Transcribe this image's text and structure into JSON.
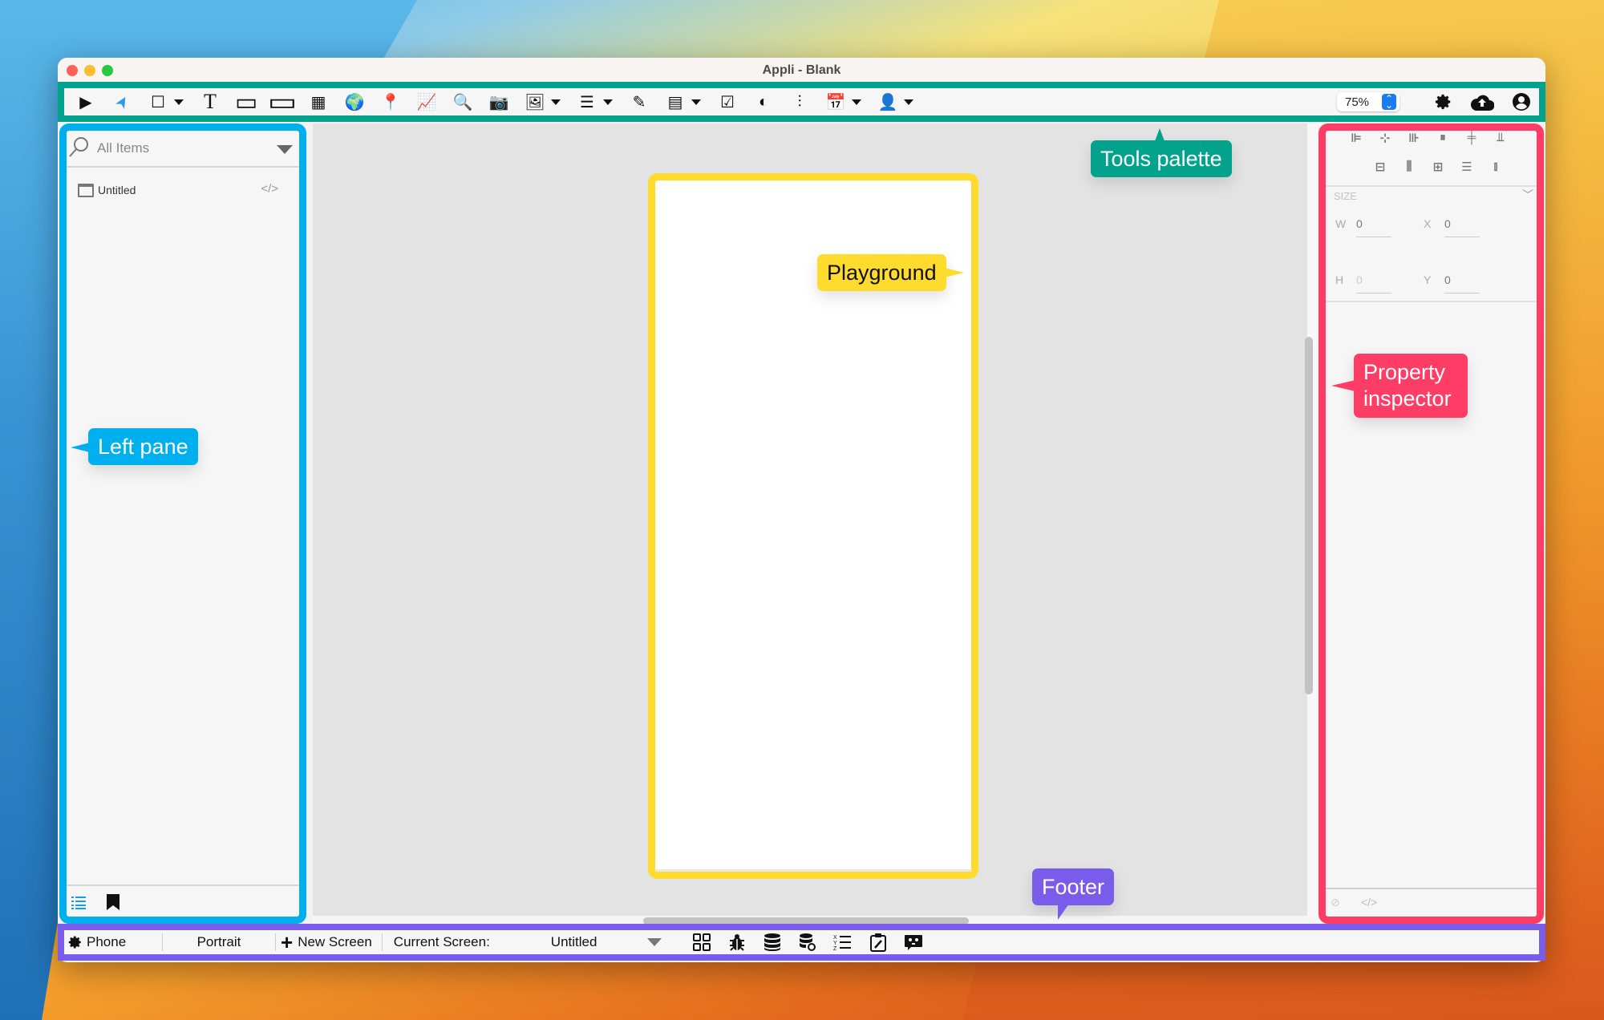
{
  "window": {
    "title": "Appli - Blank"
  },
  "toolbar": {
    "tools": [
      {
        "name": "play-icon",
        "glyph": "▶",
        "dropdown": false
      },
      {
        "name": "pointer-icon",
        "glyph": "➤",
        "dropdown": false
      },
      {
        "name": "view-icon",
        "glyph": "☐",
        "dropdown": true
      },
      {
        "name": "text-icon",
        "glyph": "T",
        "dropdown": false
      },
      {
        "name": "button-icon",
        "glyph": "▭",
        "dropdown": false
      },
      {
        "name": "textfield-icon",
        "glyph": "▭",
        "dropdown": false
      },
      {
        "name": "grid-icon",
        "glyph": "▦",
        "dropdown": false
      },
      {
        "name": "web-view-icon",
        "glyph": "🌍",
        "dropdown": false
      },
      {
        "name": "map-pin-icon",
        "glyph": "📍",
        "dropdown": false
      },
      {
        "name": "chart-icon",
        "glyph": "📈",
        "dropdown": false
      },
      {
        "name": "search-icon",
        "glyph": "🔍",
        "dropdown": false
      },
      {
        "name": "camera-icon",
        "glyph": "📷",
        "dropdown": false
      },
      {
        "name": "image-icon",
        "glyph": "🖼",
        "dropdown": true
      },
      {
        "name": "list-icon",
        "glyph": "☰",
        "dropdown": true
      },
      {
        "name": "edit-icon",
        "glyph": "✎",
        "dropdown": false
      },
      {
        "name": "picker-icon",
        "glyph": "▤",
        "dropdown": true
      },
      {
        "name": "checkbox-icon",
        "glyph": "☑",
        "dropdown": false
      },
      {
        "name": "toggle-icon",
        "glyph": "◐",
        "dropdown": false
      },
      {
        "name": "slider-icon",
        "glyph": "⫶",
        "dropdown": false
      },
      {
        "name": "calendar-icon",
        "glyph": "📅",
        "dropdown": true
      },
      {
        "name": "add-user-icon",
        "glyph": "👤",
        "dropdown": true
      }
    ],
    "zoom_value": "75%",
    "right_icons": [
      "gear-icon",
      "cloud-upload-icon",
      "account-icon"
    ]
  },
  "left_pane": {
    "search_placeholder": "All Items",
    "items": [
      {
        "label": "Untitled",
        "code_glyph": "</>"
      }
    ]
  },
  "inspector": {
    "align_row1": [
      "⊫",
      "⊹",
      "⊪",
      "⏸",
      "╪",
      "⫫"
    ],
    "align_row2": [
      "⊟",
      "⫼",
      "⊞",
      "☰",
      "⫾"
    ],
    "size_header": "SIZE",
    "fields": {
      "w_label": "W",
      "w_value": "0",
      "x_label": "X",
      "x_value": "0",
      "h_label": "H",
      "h_value": "0",
      "y_label": "Y",
      "y_value": "0"
    },
    "footer_code": "</>"
  },
  "footer": {
    "device": "Phone",
    "orientation": "Portrait",
    "new_screen": "New Screen",
    "current_screen_label": "Current Screen:",
    "current_screen_value": "Untitled"
  },
  "callouts": {
    "tools": "Tools palette",
    "playground": "Playground",
    "left": "Left pane",
    "inspector": "Property inspector",
    "footer": "Footer"
  },
  "colors": {
    "tools": "#03a28d",
    "playground": "#ffdb2e",
    "left": "#00b0ee",
    "inspector": "#fe3d67",
    "footer": "#7a5cea"
  }
}
